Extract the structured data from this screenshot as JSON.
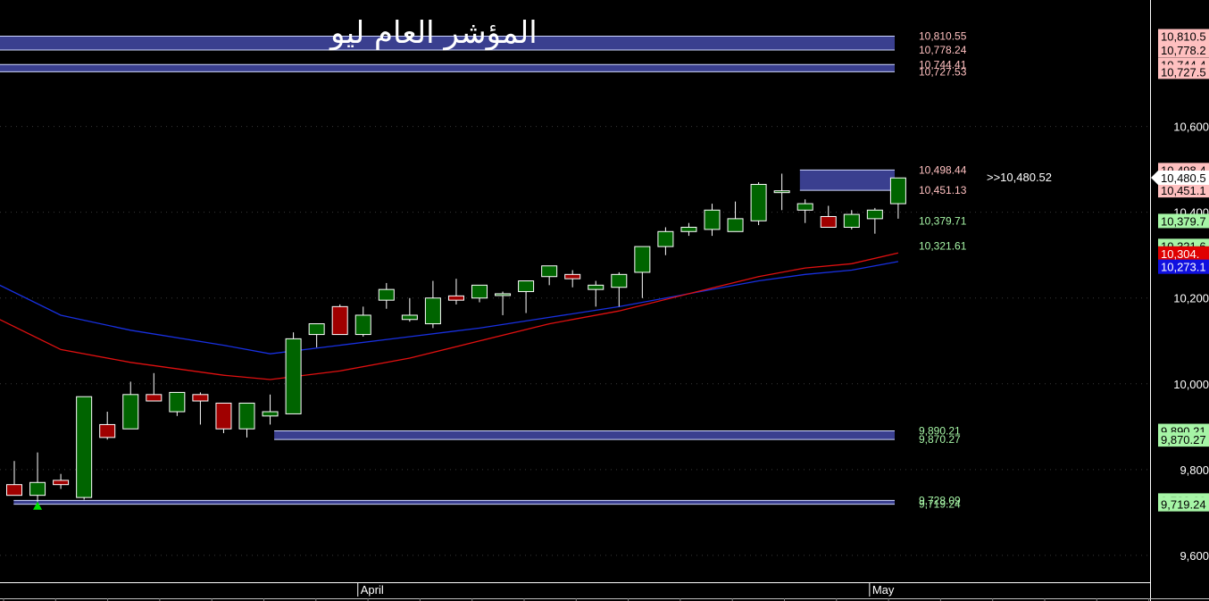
{
  "chart_data": {
    "type": "candlestick",
    "title": "المؤشر العام ليو",
    "x_labels": [
      {
        "label": "April",
        "candle_index": 15
      },
      {
        "label": "May",
        "candle_index": 37
      }
    ],
    "y_ticks": [
      {
        "value": 10600,
        "label": "10,600"
      },
      {
        "value": 10400,
        "label": "10,400"
      },
      {
        "value": 10200,
        "label": "10,200"
      },
      {
        "value": 10000,
        "label": "10,000"
      },
      {
        "value": 9800,
        "label": "9,800"
      },
      {
        "value": 9600,
        "label": "9,600"
      }
    ],
    "ylim": [
      9550,
      10840
    ],
    "candles": [
      {
        "o": 9765,
        "h": 9820,
        "l": 9755,
        "c": 9740
      },
      {
        "o": 9740,
        "h": 9840,
        "l": 9725,
        "c": 9770
      },
      {
        "o": 9775,
        "h": 9790,
        "l": 9755,
        "c": 9765
      },
      {
        "o": 9735,
        "h": 9970,
        "l": 9730,
        "c": 9970
      },
      {
        "o": 9905,
        "h": 9935,
        "l": 9870,
        "c": 9875
      },
      {
        "o": 9895,
        "h": 10005,
        "l": 9895,
        "c": 9975
      },
      {
        "o": 9975,
        "h": 10025,
        "l": 9960,
        "c": 9960
      },
      {
        "o": 9935,
        "h": 9980,
        "l": 9925,
        "c": 9980
      },
      {
        "o": 9975,
        "h": 9980,
        "l": 9905,
        "c": 9960
      },
      {
        "o": 9955,
        "h": 9955,
        "l": 9885,
        "c": 9895
      },
      {
        "o": 9895,
        "h": 9955,
        "l": 9875,
        "c": 9955
      },
      {
        "o": 9925,
        "h": 9975,
        "l": 9905,
        "c": 9935
      },
      {
        "o": 9930,
        "h": 10120,
        "l": 9930,
        "c": 10105
      },
      {
        "o": 10115,
        "h": 10140,
        "l": 10085,
        "c": 10140
      },
      {
        "o": 10180,
        "h": 10185,
        "l": 10115,
        "c": 10115
      },
      {
        "o": 10115,
        "h": 10180,
        "l": 10110,
        "c": 10160
      },
      {
        "o": 10195,
        "h": 10235,
        "l": 10175,
        "c": 10220
      },
      {
        "o": 10150,
        "h": 10200,
        "l": 10145,
        "c": 10160
      },
      {
        "o": 10140,
        "h": 10240,
        "l": 10130,
        "c": 10200
      },
      {
        "o": 10205,
        "h": 10245,
        "l": 10185,
        "c": 10195
      },
      {
        "o": 10200,
        "h": 10230,
        "l": 10190,
        "c": 10230
      },
      {
        "o": 10210,
        "h": 10215,
        "l": 10160,
        "c": 10210
      },
      {
        "o": 10215,
        "h": 10240,
        "l": 10165,
        "c": 10240
      },
      {
        "o": 10250,
        "h": 10275,
        "l": 10230,
        "c": 10275
      },
      {
        "o": 10255,
        "h": 10265,
        "l": 10225,
        "c": 10245
      },
      {
        "o": 10220,
        "h": 10240,
        "l": 10180,
        "c": 10230
      },
      {
        "o": 10225,
        "h": 10260,
        "l": 10180,
        "c": 10255
      },
      {
        "o": 10260,
        "h": 10320,
        "l": 10200,
        "c": 10320
      },
      {
        "o": 10320,
        "h": 10365,
        "l": 10300,
        "c": 10355
      },
      {
        "o": 10355,
        "h": 10375,
        "l": 10345,
        "c": 10365
      },
      {
        "o": 10360,
        "h": 10420,
        "l": 10345,
        "c": 10405
      },
      {
        "o": 10355,
        "h": 10425,
        "l": 10355,
        "c": 10385
      },
      {
        "o": 10380,
        "h": 10470,
        "l": 10370,
        "c": 10465
      },
      {
        "o": 10450,
        "h": 10490,
        "l": 10405,
        "c": 10450
      },
      {
        "o": 10405,
        "h": 10430,
        "l": 10375,
        "c": 10420
      },
      {
        "o": 10390,
        "h": 10415,
        "l": 10365,
        "c": 10365
      },
      {
        "o": 10365,
        "h": 10405,
        "l": 10360,
        "c": 10395
      },
      {
        "o": 10385,
        "h": 10410,
        "l": 10350,
        "c": 10405
      },
      {
        "o": 10420,
        "h": 10480,
        "l": 10385,
        "c": 10480
      }
    ],
    "ma_red": [
      [
        -1,
        10160
      ],
      [
        2,
        10080
      ],
      [
        5,
        10050
      ],
      [
        9,
        10020
      ],
      [
        11,
        10010
      ],
      [
        14,
        10030
      ],
      [
        17,
        10060
      ],
      [
        20,
        10100
      ],
      [
        23,
        10140
      ],
      [
        26,
        10170
      ],
      [
        29,
        10210
      ],
      [
        32,
        10250
      ],
      [
        34,
        10270
      ],
      [
        36,
        10280
      ],
      [
        38,
        10305
      ]
    ],
    "ma_blue": [
      [
        -1,
        10240
      ],
      [
        2,
        10160
      ],
      [
        5,
        10125
      ],
      [
        9,
        10090
      ],
      [
        11,
        10070
      ],
      [
        14,
        10090
      ],
      [
        17,
        10110
      ],
      [
        20,
        10130
      ],
      [
        23,
        10155
      ],
      [
        26,
        10180
      ],
      [
        29,
        10210
      ],
      [
        32,
        10240
      ],
      [
        34,
        10255
      ],
      [
        36,
        10265
      ],
      [
        38,
        10285
      ]
    ],
    "zones": [
      {
        "top": 10810.55,
        "bottom": 10778.24,
        "start_index": -1,
        "type": "supply"
      },
      {
        "top": 10744.41,
        "bottom": 10727.53,
        "start_index": -1,
        "type": "supply"
      },
      {
        "top": 10498.44,
        "bottom": 10451.13,
        "start_index": 34.1,
        "type": "supply"
      },
      {
        "top": 9890.21,
        "bottom": 9870.27,
        "start_index": 11.5,
        "type": "demand"
      },
      {
        "top": 9728.09,
        "bottom": 9719.24,
        "start_index": 0.3,
        "type": "demand"
      }
    ],
    "price_labels": [
      {
        "text": "10,810.55",
        "value": 10810.55,
        "color": "#ffc0c0",
        "badge": "10,810.5",
        "badge_bg": "#ffc0c0"
      },
      {
        "text": "10,778.24",
        "value": 10778.24,
        "color": "#ffc0c0",
        "badge": "10,778.2",
        "badge_bg": "#ffc0c0"
      },
      {
        "text": "10,744.41",
        "value": 10744.41,
        "color": "#ffc0c0",
        "badge": "10,744.4",
        "badge_bg": "#ffc0c0"
      },
      {
        "text": "10,727.53",
        "value": 10727.53,
        "color": "#ffc0c0",
        "badge": "10,727.5",
        "badge_bg": "#ffc0c0"
      },
      {
        "text": "10,498.44",
        "value": 10498.44,
        "color": "#ffc0c0",
        "badge": "10,498.4",
        "badge_bg": "#ffc0c0"
      },
      {
        "text": "10,451.13",
        "value": 10451.13,
        "color": "#ffc0c0",
        "badge": "10,451.1",
        "badge_bg": "#ffc0c0"
      },
      {
        "text": "10,379.71",
        "value": 10379.71,
        "color": "#a6f5a6",
        "badge": "10,379.7",
        "badge_bg": "#a6f5a6"
      },
      {
        "text": "10,321.61",
        "value": 10321.61,
        "color": "#a6f5a6",
        "badge": "10,321.6",
        "badge_bg": "#a6f5a6"
      },
      {
        "text": "9,890.21",
        "value": 9890.21,
        "color": "#a6f5a6",
        "badge": "9,890.21",
        "badge_bg": "#a6f5a6"
      },
      {
        "text": "9,870.27",
        "value": 9870.27,
        "color": "#a6f5a6",
        "badge": "9,870.27",
        "badge_bg": "#a6f5a6"
      },
      {
        "text": "9,728.09",
        "value": 9728.09,
        "color": "#a6f5a6",
        "badge": "9,728.09",
        "badge_bg": "#a6f5a6"
      },
      {
        "text": "9,719.24",
        "value": 9719.24,
        "color": "#a6f5a6",
        "badge": "9,719.24",
        "badge_bg": "#a6f5a6"
      }
    ],
    "ma_badges": [
      {
        "text": "10,304.",
        "value": 10304,
        "bg": "#e00000"
      },
      {
        "text": "10,273.1",
        "value": 10273,
        "bg": "#1010e0"
      }
    ],
    "last_price": {
      "text": ">>10,480.52",
      "badge": "10,480.5",
      "value": 10480.52
    },
    "signal_marker": {
      "candle_index": 1,
      "value": 9715
    }
  },
  "colors": {
    "background": "#000000",
    "up_candle": "#006400",
    "down_candle": "#a00000",
    "wick": "#ffffff",
    "zone_fill": "#3a3f8f",
    "zone_edge": "#d0d8ff",
    "ma_red": "#e01010",
    "ma_blue": "#1830e0",
    "grid": "#3a3a3a",
    "signal": "#00e000"
  }
}
